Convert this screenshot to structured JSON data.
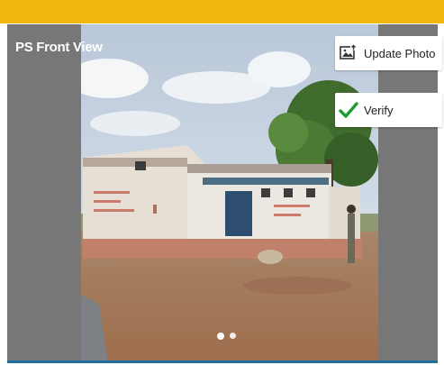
{
  "header": {
    "bar_color": "#f0b80e"
  },
  "card": {
    "title": "PS Front View",
    "photo_alt": "ps-front-view-photo"
  },
  "actions": {
    "update_photo_label": "Update Photo",
    "update_photo_icon": "photo-upload-icon",
    "verify_label": "Verify",
    "verify_icon": "checkmark-icon",
    "verify_icon_color": "#1b9e2a"
  },
  "carousel": {
    "page_count": 2,
    "active_index": 0
  }
}
